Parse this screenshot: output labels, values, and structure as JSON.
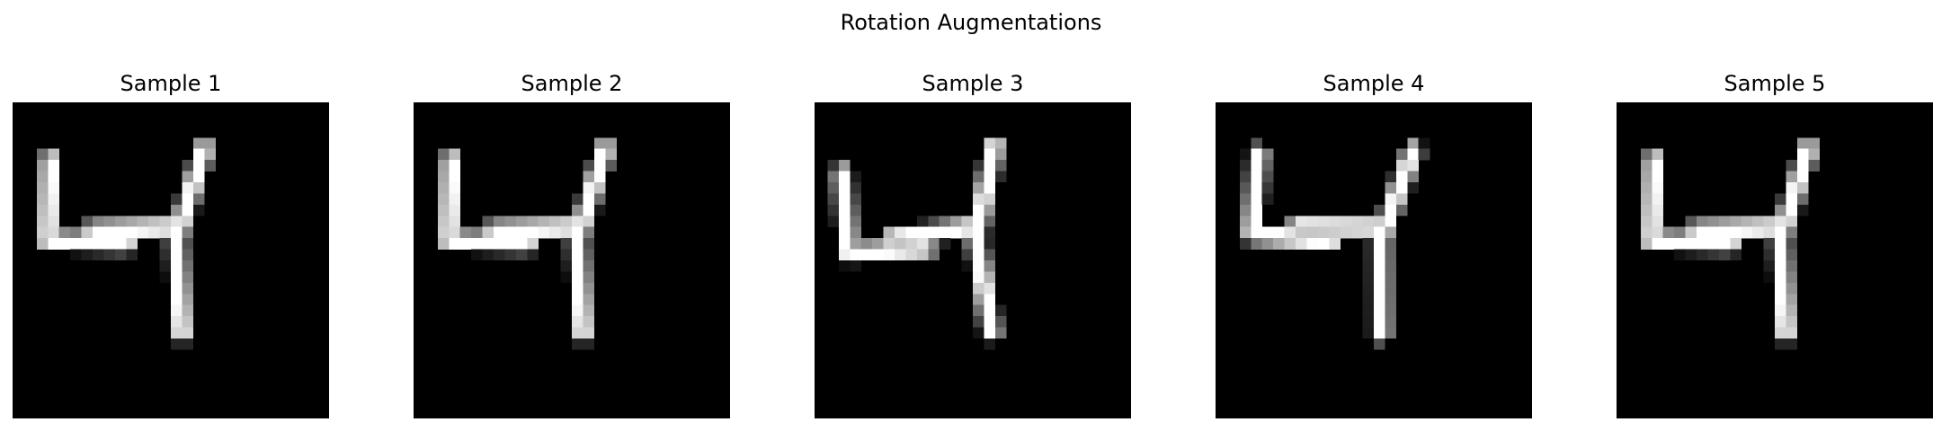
{
  "figure": {
    "title": "Rotation Augmentations",
    "panels": [
      {
        "title": "Sample 1",
        "rotation_deg": 0,
        "shift": [
          0,
          0
        ]
      },
      {
        "title": "Sample 2",
        "rotation_deg": 0,
        "shift": [
          0,
          0
        ]
      },
      {
        "title": "Sample 3",
        "rotation_deg": -6,
        "shift": [
          0,
          0
        ]
      },
      {
        "title": "Sample 4",
        "rotation_deg": 3,
        "shift": [
          0,
          0
        ]
      },
      {
        "title": "Sample 5",
        "rotation_deg": 0,
        "shift": [
          0,
          0
        ]
      }
    ],
    "image_content": "handwritten digit 4, grayscale 28x28"
  }
}
